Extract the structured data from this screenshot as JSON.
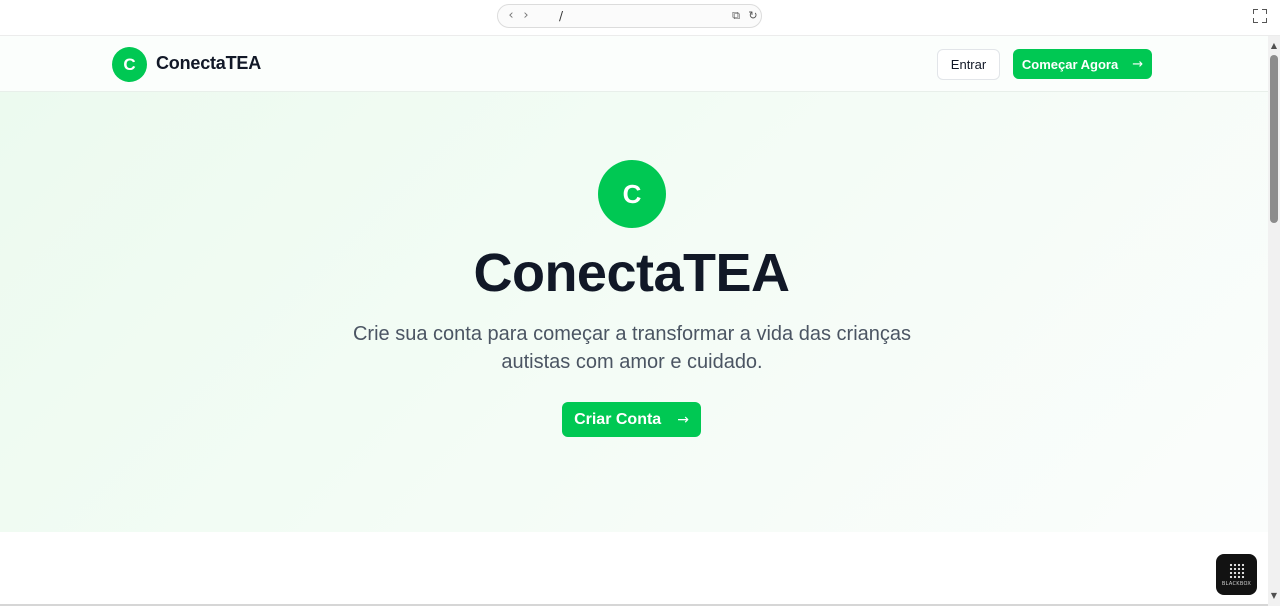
{
  "browser": {
    "back_glyph": "‹",
    "forward_glyph": "›",
    "url": "/",
    "open_external_glyph": "⧉",
    "reload_glyph": "↻"
  },
  "header": {
    "logo_letter": "C",
    "brand": "ConectaTEA",
    "login_label": "Entrar",
    "cta_label": "Começar Agora",
    "cta_arrow": "→"
  },
  "hero": {
    "logo_letter": "C",
    "title": "ConectaTEA",
    "subtitle": "Crie sua conta para começar a transformar a vida das crianças autistas com amor e cuidado.",
    "cta_label": "Criar Conta",
    "cta_arrow": "→"
  },
  "widget": {
    "label": "BLACKBOX"
  },
  "colors": {
    "accent": "#00c853",
    "text_dark": "#111827",
    "text_muted": "#4b5563"
  }
}
